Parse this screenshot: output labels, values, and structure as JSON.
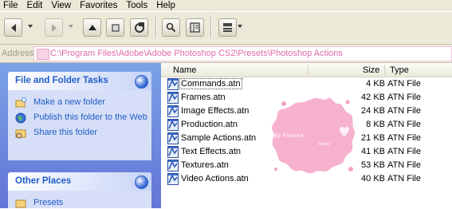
{
  "menubar": {
    "items": [
      {
        "label": "File"
      },
      {
        "label": "Edit"
      },
      {
        "label": "View"
      },
      {
        "label": "Favorites"
      },
      {
        "label": "Tools"
      },
      {
        "label": "Help"
      }
    ]
  },
  "toolbar": {
    "buttons": [
      {
        "icon": "back-arrow-icon",
        "enabled": true
      },
      {
        "icon": "forward-arrow-icon",
        "enabled": false
      },
      {
        "icon": "up-folder-icon",
        "enabled": true
      },
      {
        "icon": "stop-icon",
        "enabled": true
      },
      {
        "icon": "refresh-icon",
        "enabled": true
      },
      {
        "icon": "search-icon",
        "enabled": true
      },
      {
        "icon": "folders-icon",
        "enabled": true
      },
      {
        "icon": "views-icon",
        "enabled": true
      }
    ]
  },
  "address": {
    "label": "Address",
    "path": "C:\\Program Files\\Adobe\\Adobe Photoshop CS2\\Presets\\Photoshop Actions"
  },
  "sidebar": {
    "file_tasks": {
      "title": "File and Folder Tasks",
      "items": [
        {
          "label": "Make a new folder",
          "icon": "new-folder-icon"
        },
        {
          "label": "Publish this folder to the Web",
          "icon": "globe-icon"
        },
        {
          "label": "Share this folder",
          "icon": "share-folder-icon"
        }
      ]
    },
    "other_places": {
      "title": "Other Places",
      "items": [
        {
          "label": "Presets",
          "icon": "folder-icon"
        }
      ]
    }
  },
  "columns": {
    "name": "Name",
    "size": "Size",
    "type": "Type"
  },
  "files": [
    {
      "name": "Commands.atn",
      "size": "4 KB",
      "type": "ATN File"
    },
    {
      "name": "Frames.atn",
      "size": "42 KB",
      "type": "ATN File"
    },
    {
      "name": "Image Effects.atn",
      "size": "24 KB",
      "type": "ATN File"
    },
    {
      "name": "Production.atn",
      "size": "8 KB",
      "type": "ATN File"
    },
    {
      "name": "Sample Actions.atn",
      "size": "21 KB",
      "type": "ATN File"
    },
    {
      "name": "Text Effects.atn",
      "size": "41 KB",
      "type": "ATN File"
    },
    {
      "name": "Textures.atn",
      "size": "53 KB",
      "type": "ATN File"
    },
    {
      "name": "Video Actions.atn",
      "size": "40 KB",
      "type": "ATN File"
    }
  ],
  "watermark": {
    "text": "By Foniixe",
    "subtext": "Foniiz",
    "color": "#f4a3c6"
  },
  "colors": {
    "task_link": "#215dc6",
    "address_text": "#e06aa8",
    "sidebar_bg": "#6f8ee0"
  }
}
